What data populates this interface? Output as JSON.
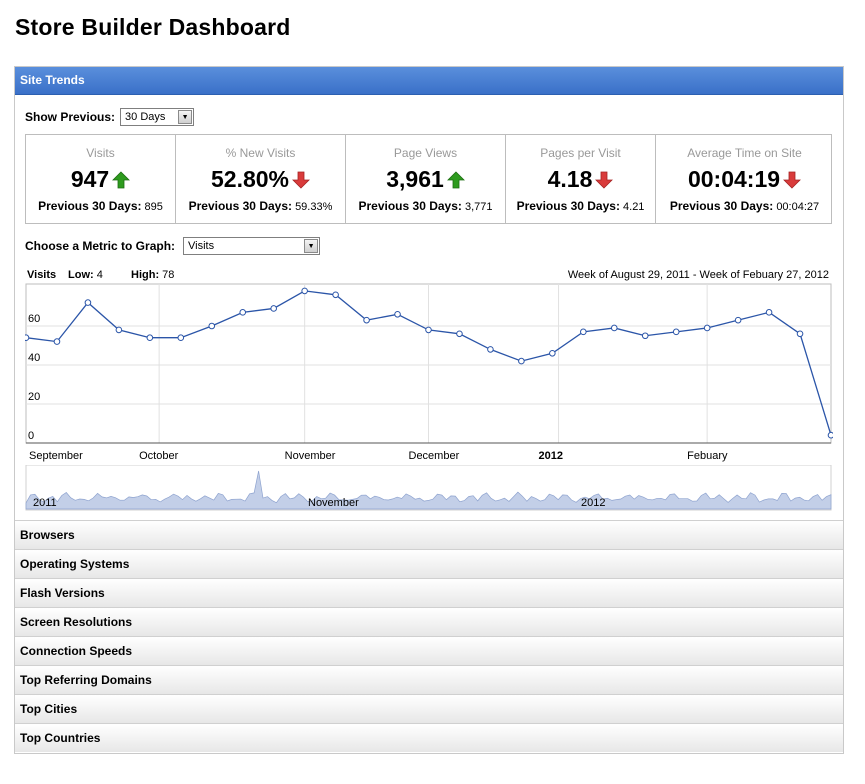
{
  "page": {
    "title": "Store Builder Dashboard"
  },
  "site_trends": {
    "header": "Site Trends",
    "show_previous_label": "Show Previous:",
    "show_previous_value": "30 Days",
    "metrics": [
      {
        "label": "Visits",
        "value": "947",
        "trend": "up",
        "prev_label": "Previous 30 Days:",
        "prev_value": "895"
      },
      {
        "label": "% New Visits",
        "value": "52.80%",
        "trend": "down",
        "prev_label": "Previous 30 Days:",
        "prev_value": "59.33%"
      },
      {
        "label": "Page Views",
        "value": "3,961",
        "trend": "up",
        "prev_label": "Previous 30 Days:",
        "prev_value": "3,771"
      },
      {
        "label": "Pages per Visit",
        "value": "4.18",
        "trend": "down",
        "prev_label": "Previous 30 Days:",
        "prev_value": "4.21"
      },
      {
        "label": "Average Time on Site",
        "value": "00:04:19",
        "trend": "down",
        "prev_label": "Previous 30 Days:",
        "prev_value": "00:04:27"
      }
    ],
    "choose_metric_label": "Choose a Metric to Graph:",
    "choose_metric_value": "Visits",
    "chart_header": {
      "metric": "Visits",
      "low_label": "Low:",
      "low_value": "4",
      "high_label": "High:",
      "high_value": "78",
      "range": "Week of August 29, 2011 - Week of Febuary 27, 2012"
    }
  },
  "chart_data": {
    "type": "line",
    "ylim": [
      0,
      80
    ],
    "yticks": [
      0,
      20,
      40,
      60
    ],
    "values": [
      54,
      52,
      72,
      58,
      54,
      54,
      60,
      67,
      69,
      78,
      76,
      63,
      66,
      58,
      56,
      48,
      42,
      46,
      57,
      59,
      55,
      57,
      59,
      63,
      67,
      56,
      4
    ],
    "month_labels": [
      "September",
      "October",
      "November",
      "December",
      "2012",
      "Febuary"
    ],
    "overview_labels": [
      "2011",
      "November",
      "2012"
    ],
    "line_color": "#2b55a8",
    "grid": true
  },
  "sections": [
    "Browsers",
    "Operating Systems",
    "Flash Versions",
    "Screen Resolutions",
    "Connection Speeds",
    "Top Referring Domains",
    "Top Cities",
    "Top Countries"
  ],
  "colors": {
    "header_blue": "#3a70c8",
    "up_arrow": "#2e9b1e",
    "down_arrow": "#d93b3b"
  }
}
